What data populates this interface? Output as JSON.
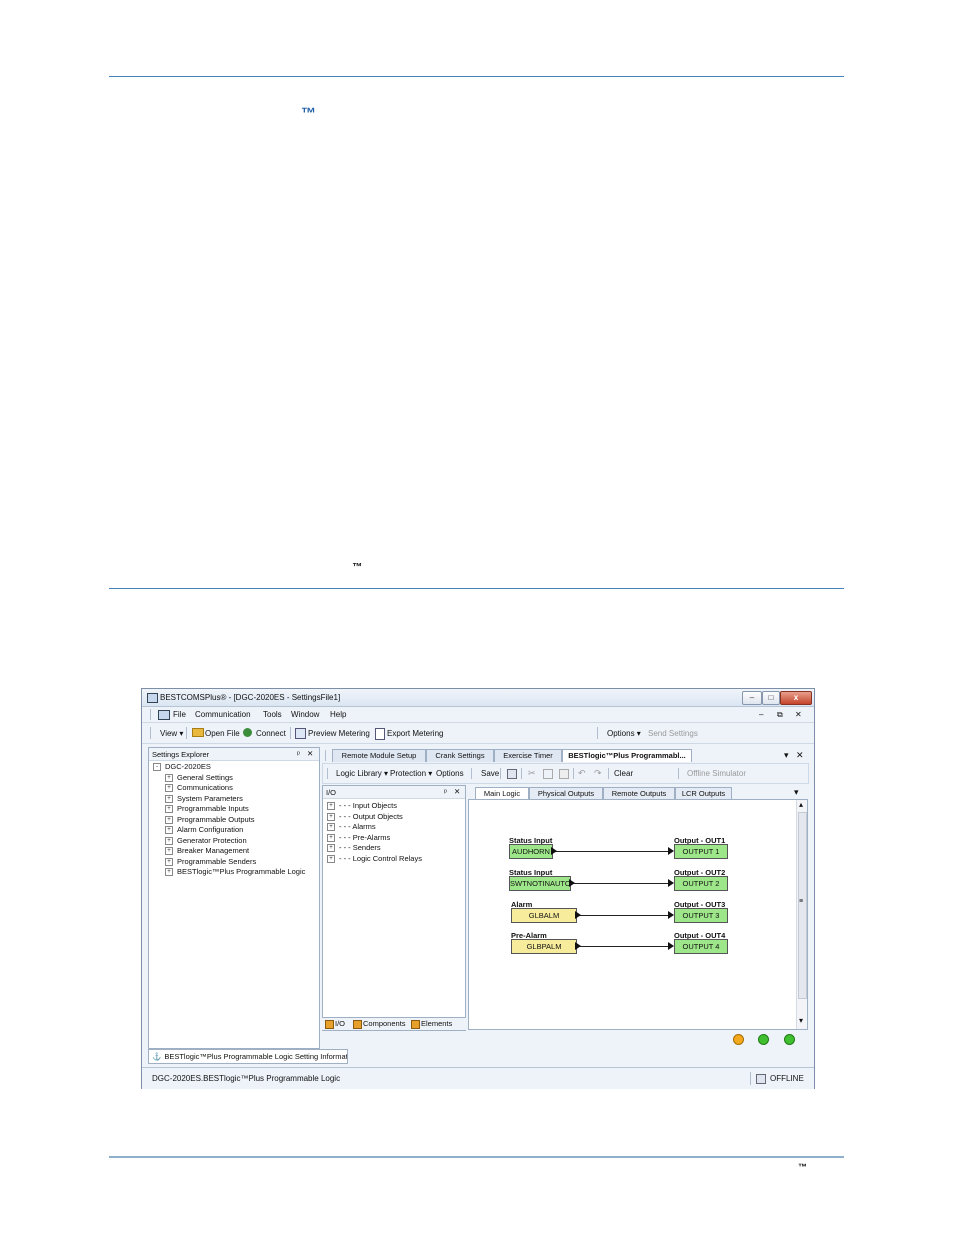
{
  "page": {
    "tm_top": "™",
    "tm_middle": "™",
    "tm_footer": "™"
  },
  "window": {
    "title": "BESTCOMSPlus® - [DGC-2020ES - SettingsFile1]",
    "buttons": {
      "minimize": "–",
      "maximize": "□",
      "close": "x"
    }
  },
  "menu": {
    "items": [
      "File",
      "Communication",
      "Tools",
      "Window",
      "Help"
    ],
    "controls": [
      "–",
      "⧉",
      "✕"
    ]
  },
  "toolbar": {
    "view": "View ▾",
    "open_file": "Open File",
    "connect": "Connect",
    "preview_metering": "Preview Metering",
    "export_metering": "Export Metering",
    "options": "Options ▾",
    "send_settings": "Send Settings"
  },
  "settings_explorer": {
    "title": "Settings Explorer",
    "pin": "ᵖ",
    "close": "✕",
    "root": "DGC-2020ES",
    "items": [
      "General Settings",
      "Communications",
      "System Parameters",
      "Programmable Inputs",
      "Programmable Outputs",
      "Alarm Configuration",
      "Generator Protection",
      "Breaker Management",
      "Programmable Senders",
      "BESTlogic™Plus Programmable Logic"
    ]
  },
  "doc_tabs": {
    "tabs": [
      "Remote Module Setup",
      "Crank Settings",
      "Exercise Timer",
      "BESTlogic™Plus Programmabl..."
    ],
    "active": 3,
    "dropdown": "▾",
    "close": "✕"
  },
  "logic_toolbar": {
    "logic_library": "Logic Library ▾",
    "protection": "Protection ▾",
    "options": "Options",
    "save": "Save",
    "clear": "Clear",
    "offline_simulator": "Offline Simulator"
  },
  "io_panel": {
    "title": "I/O",
    "pin": "ᵖ",
    "close": "✕",
    "items": [
      "Input Objects",
      "Output Objects",
      "Alarms",
      "Pre-Alarms",
      "Senders",
      "Logic Control Relays"
    ],
    "bottom_tabs": [
      "I/O",
      "Components",
      "Elements"
    ]
  },
  "sub_tabs": {
    "tabs": [
      "Main Logic",
      "Physical Outputs",
      "Remote Outputs",
      "LCR Outputs"
    ],
    "active": 0,
    "dropdown": "▾"
  },
  "diagram": {
    "rows": [
      {
        "in_label": "Status Input",
        "in_block": "AUDHORN",
        "in_color": "green",
        "out_label": "Output - OUT1",
        "out_block": "OUTPUT 1"
      },
      {
        "in_label": "Status Input",
        "in_block": "SWTNOTINAUTO",
        "in_color": "green",
        "out_label": "Output - OUT2",
        "out_block": "OUTPUT 2"
      },
      {
        "in_label": "Alarm",
        "in_block": "GLBALM",
        "in_color": "yellow",
        "out_label": "Output - OUT3",
        "out_block": "OUTPUT 3"
      },
      {
        "in_label": "Pre-Alarm",
        "in_block": "GLBPALM",
        "in_color": "yellow",
        "out_label": "Output - OUT4",
        "out_block": "OUTPUT 4"
      }
    ],
    "scroll_up": "▴",
    "scroll_down": "▾",
    "scroll_mark": "≡"
  },
  "status_leds": [
    "#f2a91d",
    "#3fbf2f",
    "#3fbf2f"
  ],
  "info_tab": "BESTlogic™Plus Programmable Logic Setting Informati",
  "status_bar": {
    "path": "DGC-2020ES.BESTlogic™Plus Programmable Logic",
    "mode": "OFFLINE"
  }
}
